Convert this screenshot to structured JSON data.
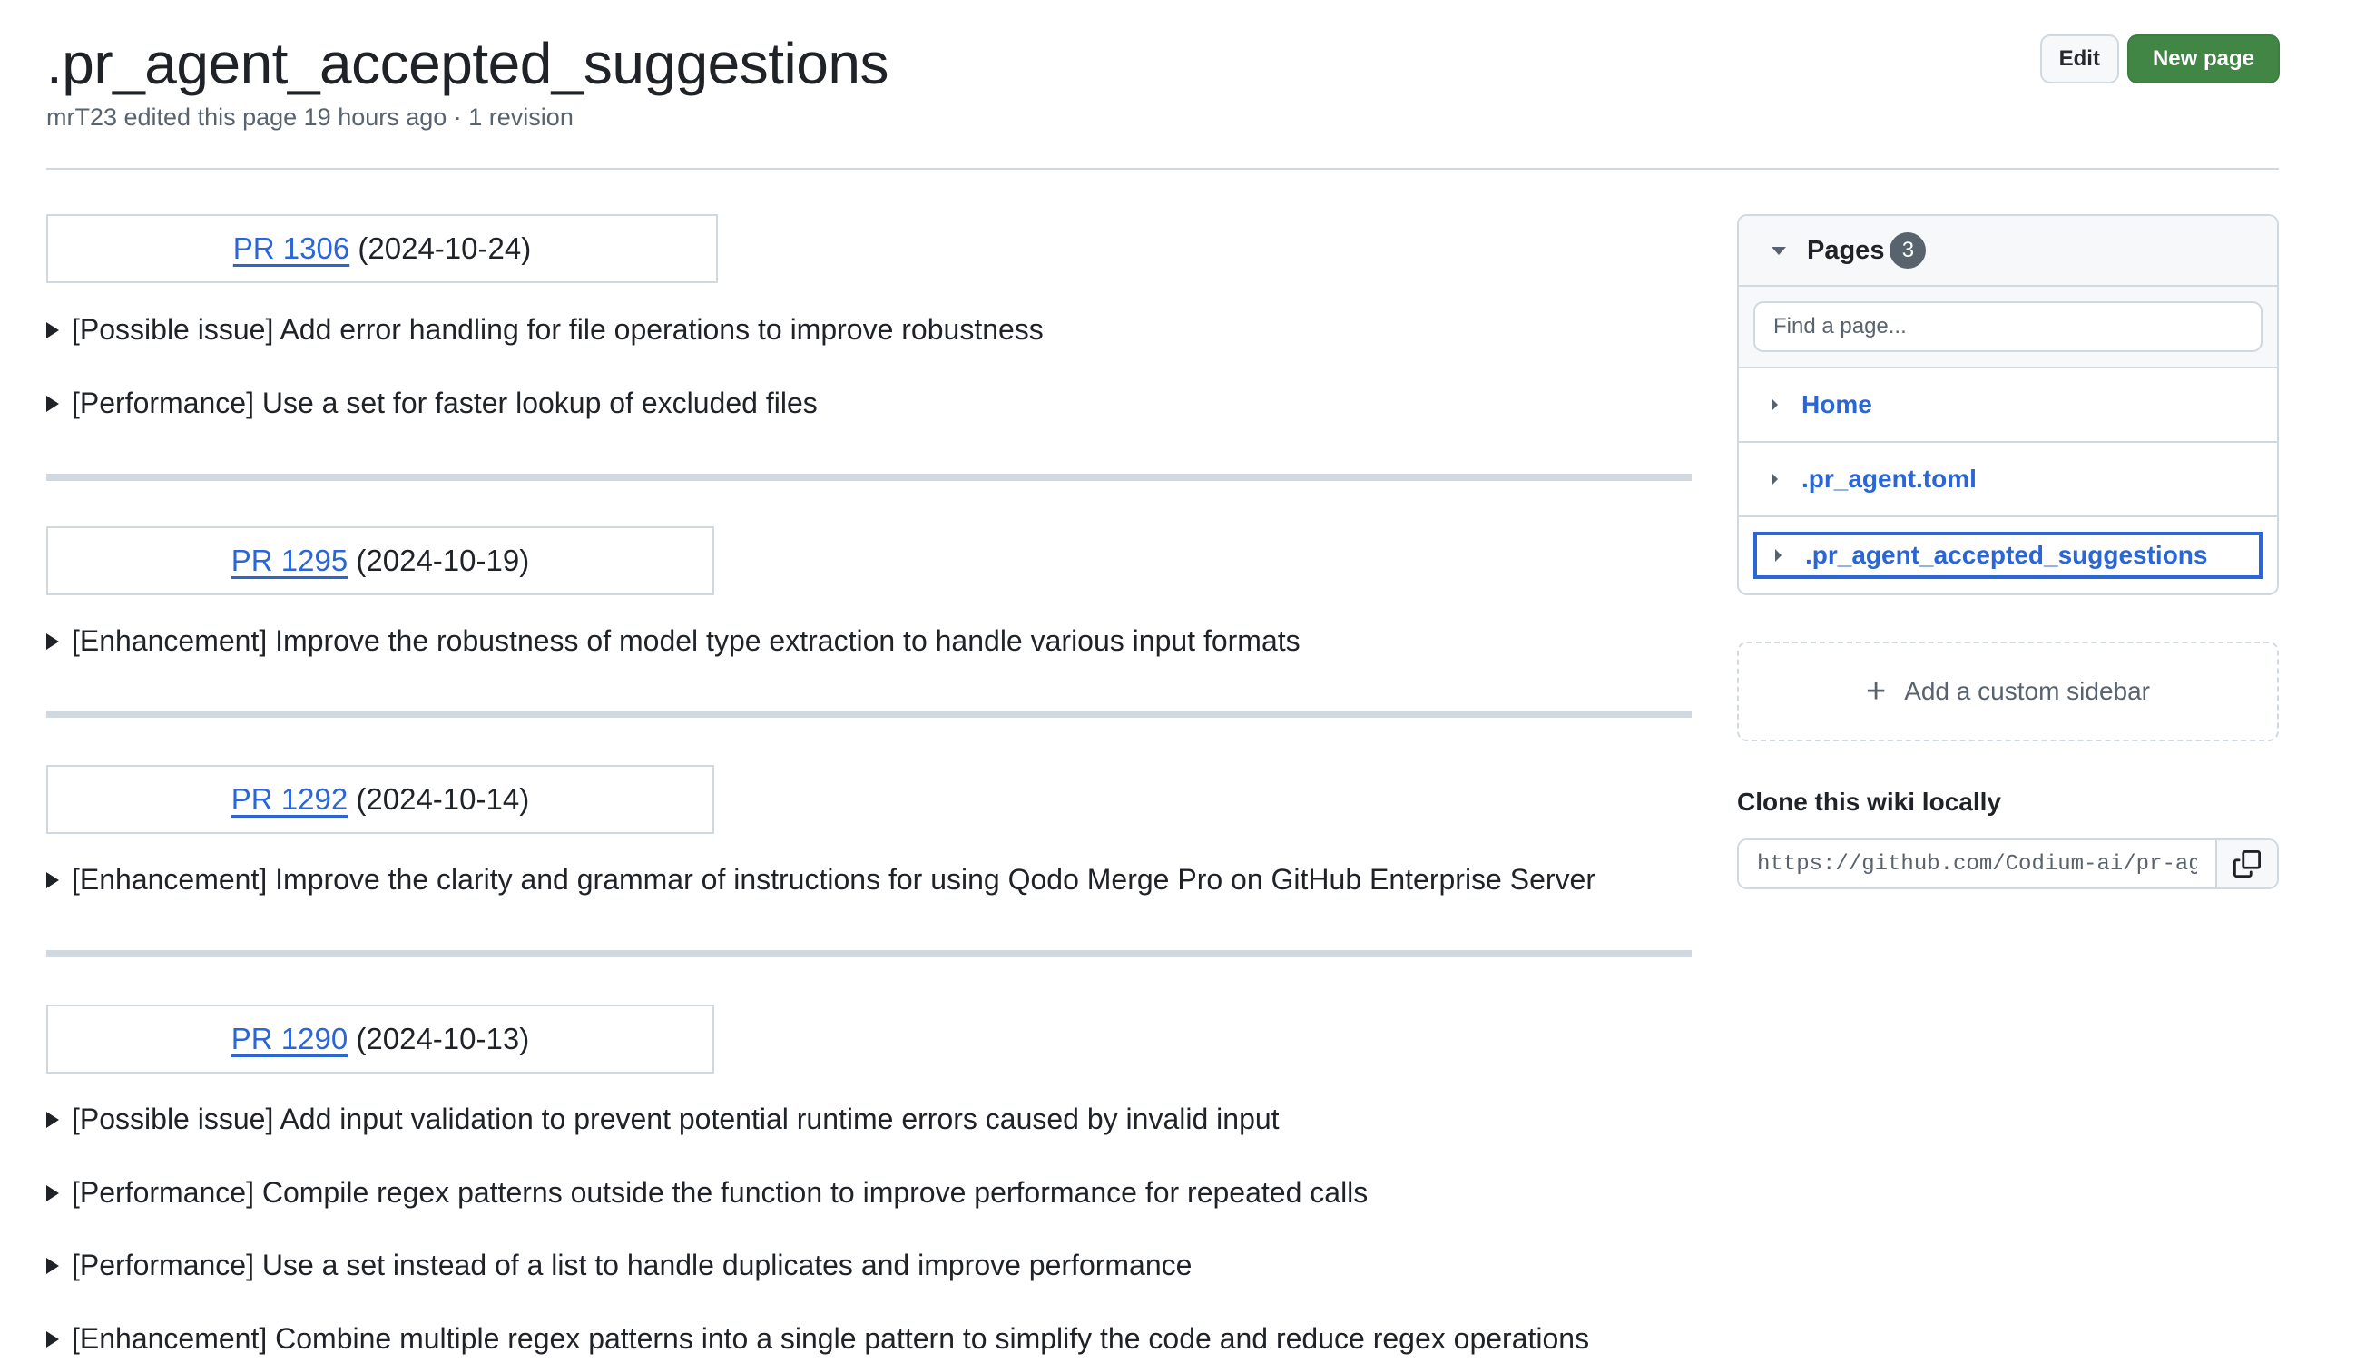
{
  "header": {
    "title": ".pr_agent_accepted_suggestions",
    "subtitle": "mrT23 edited this page 19 hours ago · 1 revision",
    "edit_label": "Edit",
    "new_page_label": "New page"
  },
  "prs": [
    {
      "link": "PR 1306",
      "date": "(2024-10-24)",
      "items": [
        "[Possible issue] Add error handling for file operations to improve robustness",
        "[Performance] Use a set for faster lookup of excluded files"
      ]
    },
    {
      "link": "PR 1295",
      "date": "(2024-10-19)",
      "items": [
        "[Enhancement] Improve the robustness of model type extraction to handle various input formats"
      ]
    },
    {
      "link": "PR 1292",
      "date": "(2024-10-14)",
      "items": [
        "[Enhancement] Improve the clarity and grammar of instructions for using Qodo Merge Pro on GitHub Enterprise Server"
      ]
    },
    {
      "link": "PR 1290",
      "date": "(2024-10-13)",
      "items": [
        "[Possible issue] Add input validation to prevent potential runtime errors caused by invalid input",
        "[Performance] Compile regex patterns outside the function to improve performance for repeated calls",
        "[Performance] Use a set instead of a list to handle duplicates and improve performance",
        "[Enhancement] Combine multiple regex patterns into a single pattern to simplify the code and reduce regex operations"
      ]
    }
  ],
  "sidebar": {
    "pages_title": "Pages",
    "pages_count": "3",
    "filter_placeholder": "Find a page...",
    "pages": [
      {
        "label": "Home"
      },
      {
        "label": ".pr_agent.toml"
      },
      {
        "label": ".pr_agent_accepted_suggestions",
        "active": true
      }
    ],
    "add_sidebar_label": "Add a custom sidebar",
    "clone_title": "Clone this wiki locally",
    "clone_url": "https://github.com/Codium-ai/pr-agent.wiki.git"
  },
  "icons": {
    "disclosure": "triangle-right-icon",
    "pages_toggle": "triangle-down-icon",
    "add": "plus-icon",
    "copy": "copy-icon"
  },
  "colors": {
    "link": "#2a66d6",
    "primary_button": "#428646",
    "border": "#d1d9e0",
    "muted_text": "#59636e"
  }
}
